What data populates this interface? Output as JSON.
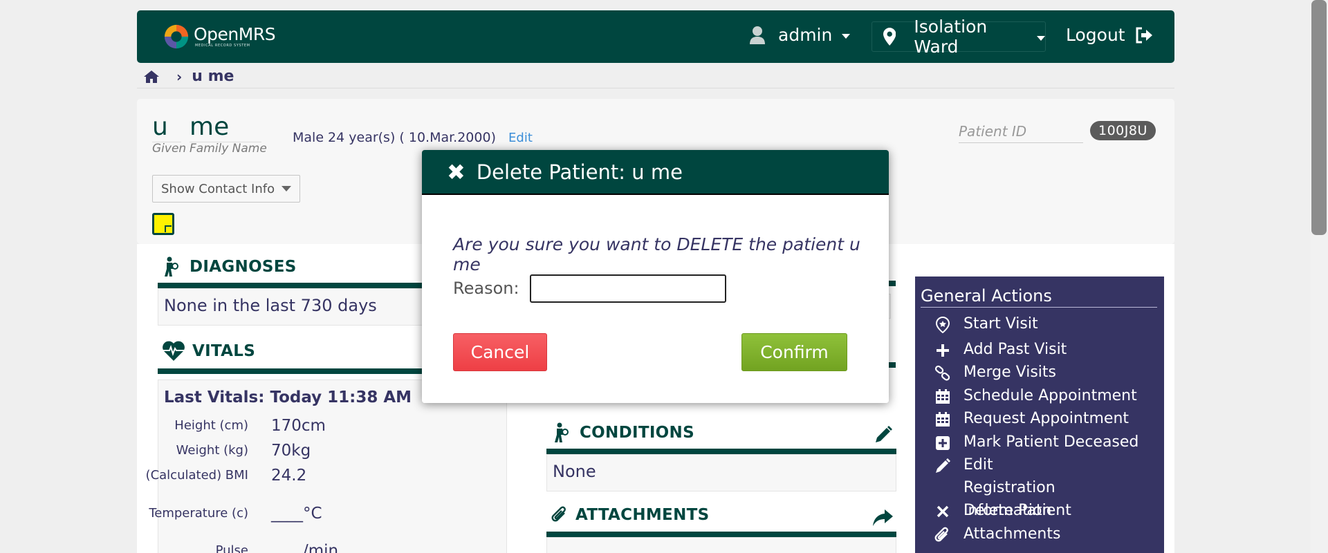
{
  "header": {
    "logo_name": "OpenMRS",
    "logo_sub": "MEDICAL RECORD SYSTEM",
    "user": "admin",
    "location": "Isolation Ward",
    "logout": "Logout",
    "bg_color": "#00463f"
  },
  "breadcrumb": {
    "current": "u me"
  },
  "patient": {
    "given": "u",
    "family": "me",
    "given_label": "Given",
    "family_label": "Family Name",
    "demographics": "Male  24 year(s) ( 10.Mar.2000)",
    "edit": "Edit",
    "id_label": "Patient ID",
    "id_value": "100J8U",
    "contact_btn": "Show Contact Info"
  },
  "diagnoses": {
    "title": "DIAGNOSES",
    "text": "None in the last 730 days"
  },
  "vitals": {
    "title": "VITALS",
    "last": "Last Vitals: Today 11:38 AM",
    "rows": [
      {
        "label": "Height (cm)",
        "value": "170cm"
      },
      {
        "label": "Weight (kg)",
        "value": "70kg"
      },
      {
        "label": "(Calculated) BMI",
        "value": "24.2"
      },
      {
        "label": "Temperature (c)",
        "value": "____°C"
      },
      {
        "label": "Pulse",
        "value": "____/min"
      }
    ]
  },
  "conditions": {
    "title": "CONDITIONS",
    "text": "None"
  },
  "attachments": {
    "title": "ATTACHMENTS"
  },
  "actions": {
    "title": "General Actions",
    "items": [
      {
        "label": "Start Visit",
        "icon": "start-visit-icon"
      },
      {
        "label": "Add Past Visit",
        "icon": "plus-icon"
      },
      {
        "label": "Merge Visits",
        "icon": "link-icon"
      },
      {
        "label": "Schedule Appointment",
        "icon": "calendar-icon"
      },
      {
        "label": "Request Appointment",
        "icon": "calendar-icon"
      },
      {
        "label": "Mark Patient Deceased",
        "icon": "plus-square-icon"
      },
      {
        "label": "Edit Registration Information",
        "icon": "pencil-icon"
      },
      {
        "label": "Delete Patient",
        "icon": "close-icon"
      },
      {
        "label": "Attachments",
        "icon": "paperclip-icon"
      }
    ]
  },
  "modal": {
    "title": "Delete Patient: u me",
    "question": "Are you sure you want to DELETE the patient u me",
    "reason_label": "Reason:",
    "reason_value": "",
    "cancel": "Cancel",
    "confirm": "Confirm"
  },
  "colors": {
    "primary": "#00463f",
    "actions_bg": "#363463",
    "cancel": "#f0494f",
    "confirm": "#80b22d"
  }
}
